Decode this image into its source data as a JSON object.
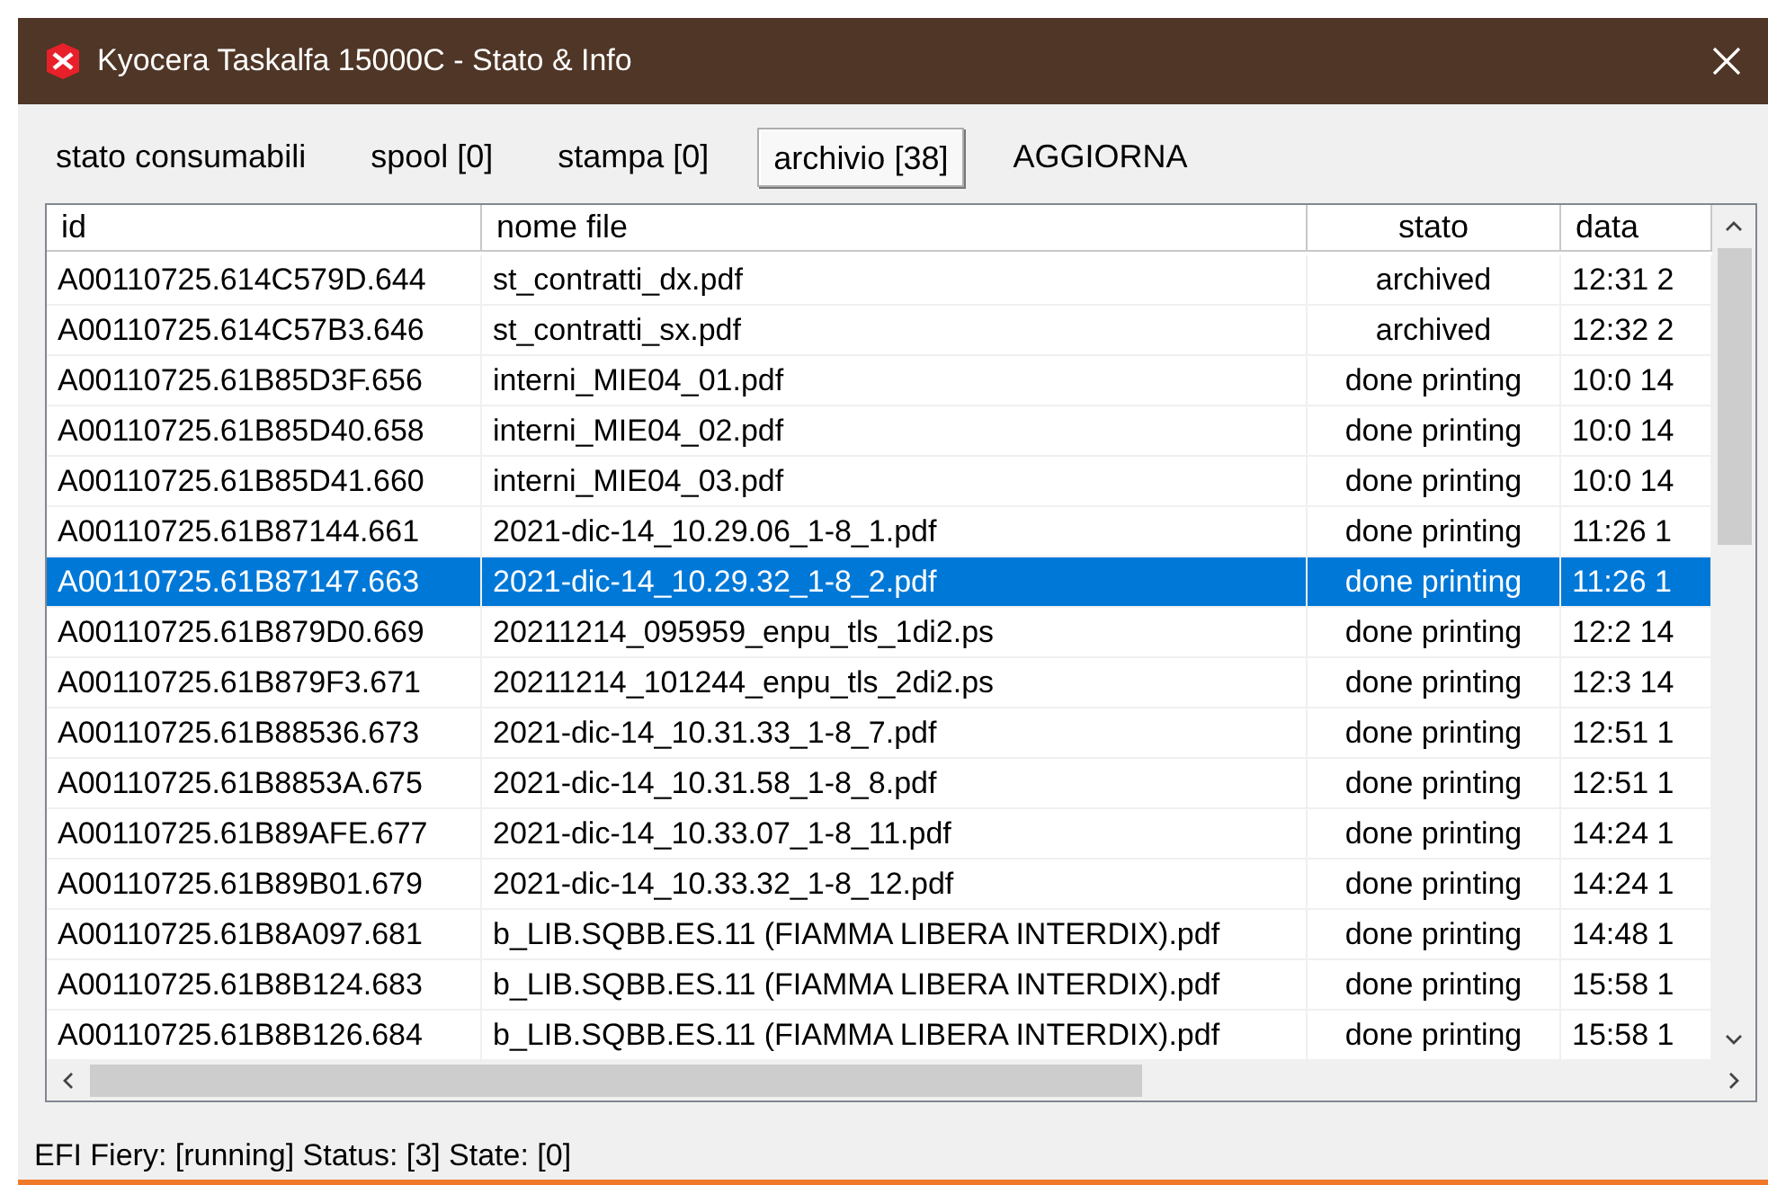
{
  "window": {
    "title": "Kyocera Taskalfa 15000C - Stato & Info"
  },
  "tabs": [
    {
      "label": "stato consumabili",
      "selected": false
    },
    {
      "label": "spool [0]",
      "selected": false
    },
    {
      "label": "stampa [0]",
      "selected": false
    },
    {
      "label": "archivio [38]",
      "selected": true
    }
  ],
  "refresh_button": "AGGIORNA",
  "table": {
    "columns": [
      "id",
      "nome file",
      "stato",
      "data"
    ],
    "rows": [
      {
        "cells": [
          "A00110725.614C579D.644",
          "st_contratti_dx.pdf",
          "archived",
          "12:31 2"
        ],
        "selected": false
      },
      {
        "cells": [
          "A00110725.614C57B3.646",
          "st_contratti_sx.pdf",
          "archived",
          "12:32 2"
        ],
        "selected": false
      },
      {
        "cells": [
          "A00110725.61B85D3F.656",
          "interni_MIE04_01.pdf",
          "done printing",
          "10:0 14"
        ],
        "selected": false
      },
      {
        "cells": [
          "A00110725.61B85D40.658",
          "interni_MIE04_02.pdf",
          "done printing",
          "10:0 14"
        ],
        "selected": false
      },
      {
        "cells": [
          "A00110725.61B85D41.660",
          "interni_MIE04_03.pdf",
          "done printing",
          "10:0 14"
        ],
        "selected": false
      },
      {
        "cells": [
          "A00110725.61B87144.661",
          "2021-dic-14_10.29.06_1-8_1.pdf",
          "done printing",
          "11:26 1"
        ],
        "selected": false
      },
      {
        "cells": [
          "A00110725.61B87147.663",
          "2021-dic-14_10.29.32_1-8_2.pdf",
          "done printing",
          "11:26 1"
        ],
        "selected": true
      },
      {
        "cells": [
          "A00110725.61B879D0.669",
          "20211214_095959_enpu_tls_1di2.ps",
          "done printing",
          "12:2 14"
        ],
        "selected": false
      },
      {
        "cells": [
          "A00110725.61B879F3.671",
          "20211214_101244_enpu_tls_2di2.ps",
          "done printing",
          "12:3 14"
        ],
        "selected": false
      },
      {
        "cells": [
          "A00110725.61B88536.673",
          "2021-dic-14_10.31.33_1-8_7.pdf",
          "done printing",
          "12:51 1"
        ],
        "selected": false
      },
      {
        "cells": [
          "A00110725.61B8853A.675",
          "2021-dic-14_10.31.58_1-8_8.pdf",
          "done printing",
          "12:51 1"
        ],
        "selected": false
      },
      {
        "cells": [
          "A00110725.61B89AFE.677",
          "2021-dic-14_10.33.07_1-8_11.pdf",
          "done printing",
          "14:24 1"
        ],
        "selected": false
      },
      {
        "cells": [
          "A00110725.61B89B01.679",
          "2021-dic-14_10.33.32_1-8_12.pdf",
          "done printing",
          "14:24 1"
        ],
        "selected": false
      },
      {
        "cells": [
          "A00110725.61B8A097.681",
          "b_LIB.SQBB.ES.11 (FIAMMA LIBERA INTERDIX).pdf",
          "done printing",
          "14:48 1"
        ],
        "selected": false
      },
      {
        "cells": [
          "A00110725.61B8B124.683",
          "b_LIB.SQBB.ES.11 (FIAMMA LIBERA INTERDIX).pdf",
          "done printing",
          "15:58 1"
        ],
        "selected": false
      },
      {
        "cells": [
          "A00110725.61B8B126.684",
          "b_LIB.SQBB.ES.11 (FIAMMA LIBERA INTERDIX).pdf",
          "done printing",
          "15:58 1"
        ],
        "selected": false
      }
    ]
  },
  "status_bar": "EFI Fiery: [running] Status: [3] State: [0]"
}
